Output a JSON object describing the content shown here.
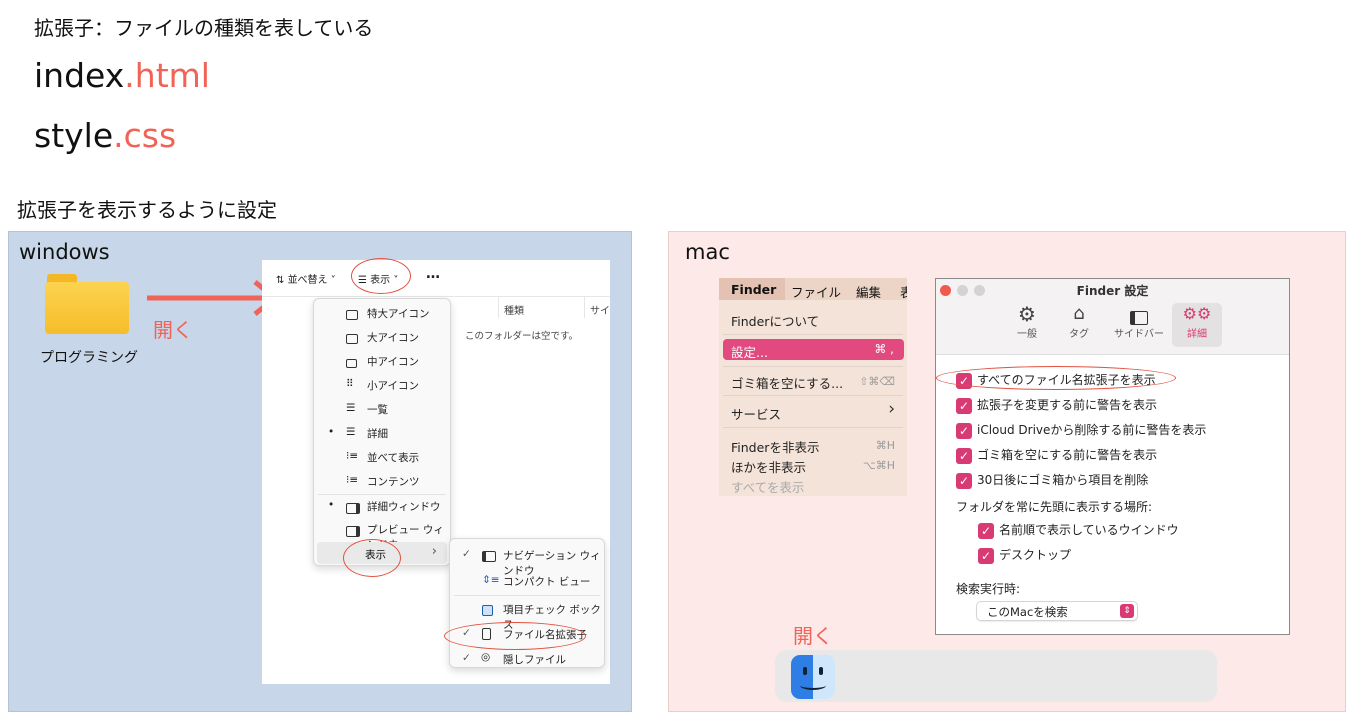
{
  "heading": "拡張子：ファイルの種類を表している",
  "file1": {
    "name": "index",
    "ext": ".html"
  },
  "file2": {
    "name": "style",
    "ext": ".css"
  },
  "section_title": "拡張子を表示するように設定",
  "windows": {
    "title": "windows",
    "folder_label": "プログラミング",
    "open_label": "開く",
    "toolbar": {
      "sort": "並べ替え",
      "view": "表示",
      "more": "…"
    },
    "column_header": "種類",
    "column_header2": "サイ",
    "empty_text": "このフォルダーは空です。",
    "view_menu": [
      {
        "label": "特大アイコン",
        "mark": "",
        "icon": "monitor-icon"
      },
      {
        "label": "大アイコン",
        "mark": "",
        "icon": "monitor-icon"
      },
      {
        "label": "中アイコン",
        "mark": "",
        "icon": "monitor-icon"
      },
      {
        "label": "小アイコン",
        "mark": "",
        "icon": "grid-icon"
      },
      {
        "label": "一覧",
        "mark": "",
        "icon": "list-icon"
      },
      {
        "label": "詳細",
        "mark": "•",
        "icon": "details-icon"
      },
      {
        "label": "並べて表示",
        "mark": "",
        "icon": "tiles-icon"
      },
      {
        "label": "コンテンツ",
        "mark": "",
        "icon": "content-icon"
      },
      {
        "label": "詳細ウィンドウ",
        "mark": "•",
        "icon": "details-pane-icon"
      },
      {
        "label": "プレビュー ウィンドウ",
        "mark": "",
        "icon": "preview-pane-icon"
      }
    ],
    "show_item": "表示",
    "show_arrow": "›",
    "show_submenu": [
      {
        "label": "ナビゲーション ウィンドウ",
        "mark": "✓",
        "icon": "nav-pane-icon"
      },
      {
        "label": "コンパクト ビュー",
        "mark": "",
        "icon": "compact-icon"
      },
      {
        "label": "項目チェック ボックス",
        "mark": "",
        "icon": "checkbox-icon"
      },
      {
        "label": "ファイル名拡張子",
        "mark": "✓",
        "icon": "file-icon"
      },
      {
        "label": "隠しファイル",
        "mark": "✓",
        "icon": "eye-icon"
      }
    ]
  },
  "mac": {
    "title": "mac",
    "open_label": "開く",
    "menubar": [
      "Finder",
      "ファイル",
      "編集",
      "表"
    ],
    "menu": {
      "about": "Finderについて",
      "settings": "設定...",
      "settings_shortcut": "⌘ ,",
      "empty_trash": "ゴミ箱を空にする...",
      "empty_trash_shortcut": "⇧⌘⌫",
      "services": "サービス",
      "services_arrow": "›",
      "hide_finder": "Finderを非表示",
      "hide_finder_shortcut": "⌘H",
      "hide_others": "ほかを非表示",
      "hide_others_shortcut": "⌥⌘H",
      "show_all": "すべてを表示"
    },
    "settings_window": {
      "title": "Finder 設定",
      "tabs": [
        {
          "label": "一般",
          "icon": "gear-icon"
        },
        {
          "label": "タグ",
          "icon": "tag-icon"
        },
        {
          "label": "サイドバー",
          "icon": "sidebar-icon"
        },
        {
          "label": "詳細",
          "icon": "gears-icon"
        }
      ],
      "options": [
        "すべてのファイル名拡張子を表示",
        "拡張子を変更する前に警告を表示",
        "iCloud Driveから削除する前に警告を表示",
        "ゴミ箱を空にする前に警告を表示",
        "30日後にゴミ箱から項目を削除"
      ],
      "folders_label": "フォルダを常に先頭に表示する場所:",
      "folder_options": [
        "名前順で表示しているウインドウ",
        "デスクトップ"
      ],
      "search_label": "検索実行時:",
      "search_value": "このMacを検索"
    }
  },
  "colors": {
    "accent": "#f06356",
    "windows_bg": "#c7d6e8",
    "mac_bg": "#fde9e7",
    "checkbox": "#d83a73"
  }
}
